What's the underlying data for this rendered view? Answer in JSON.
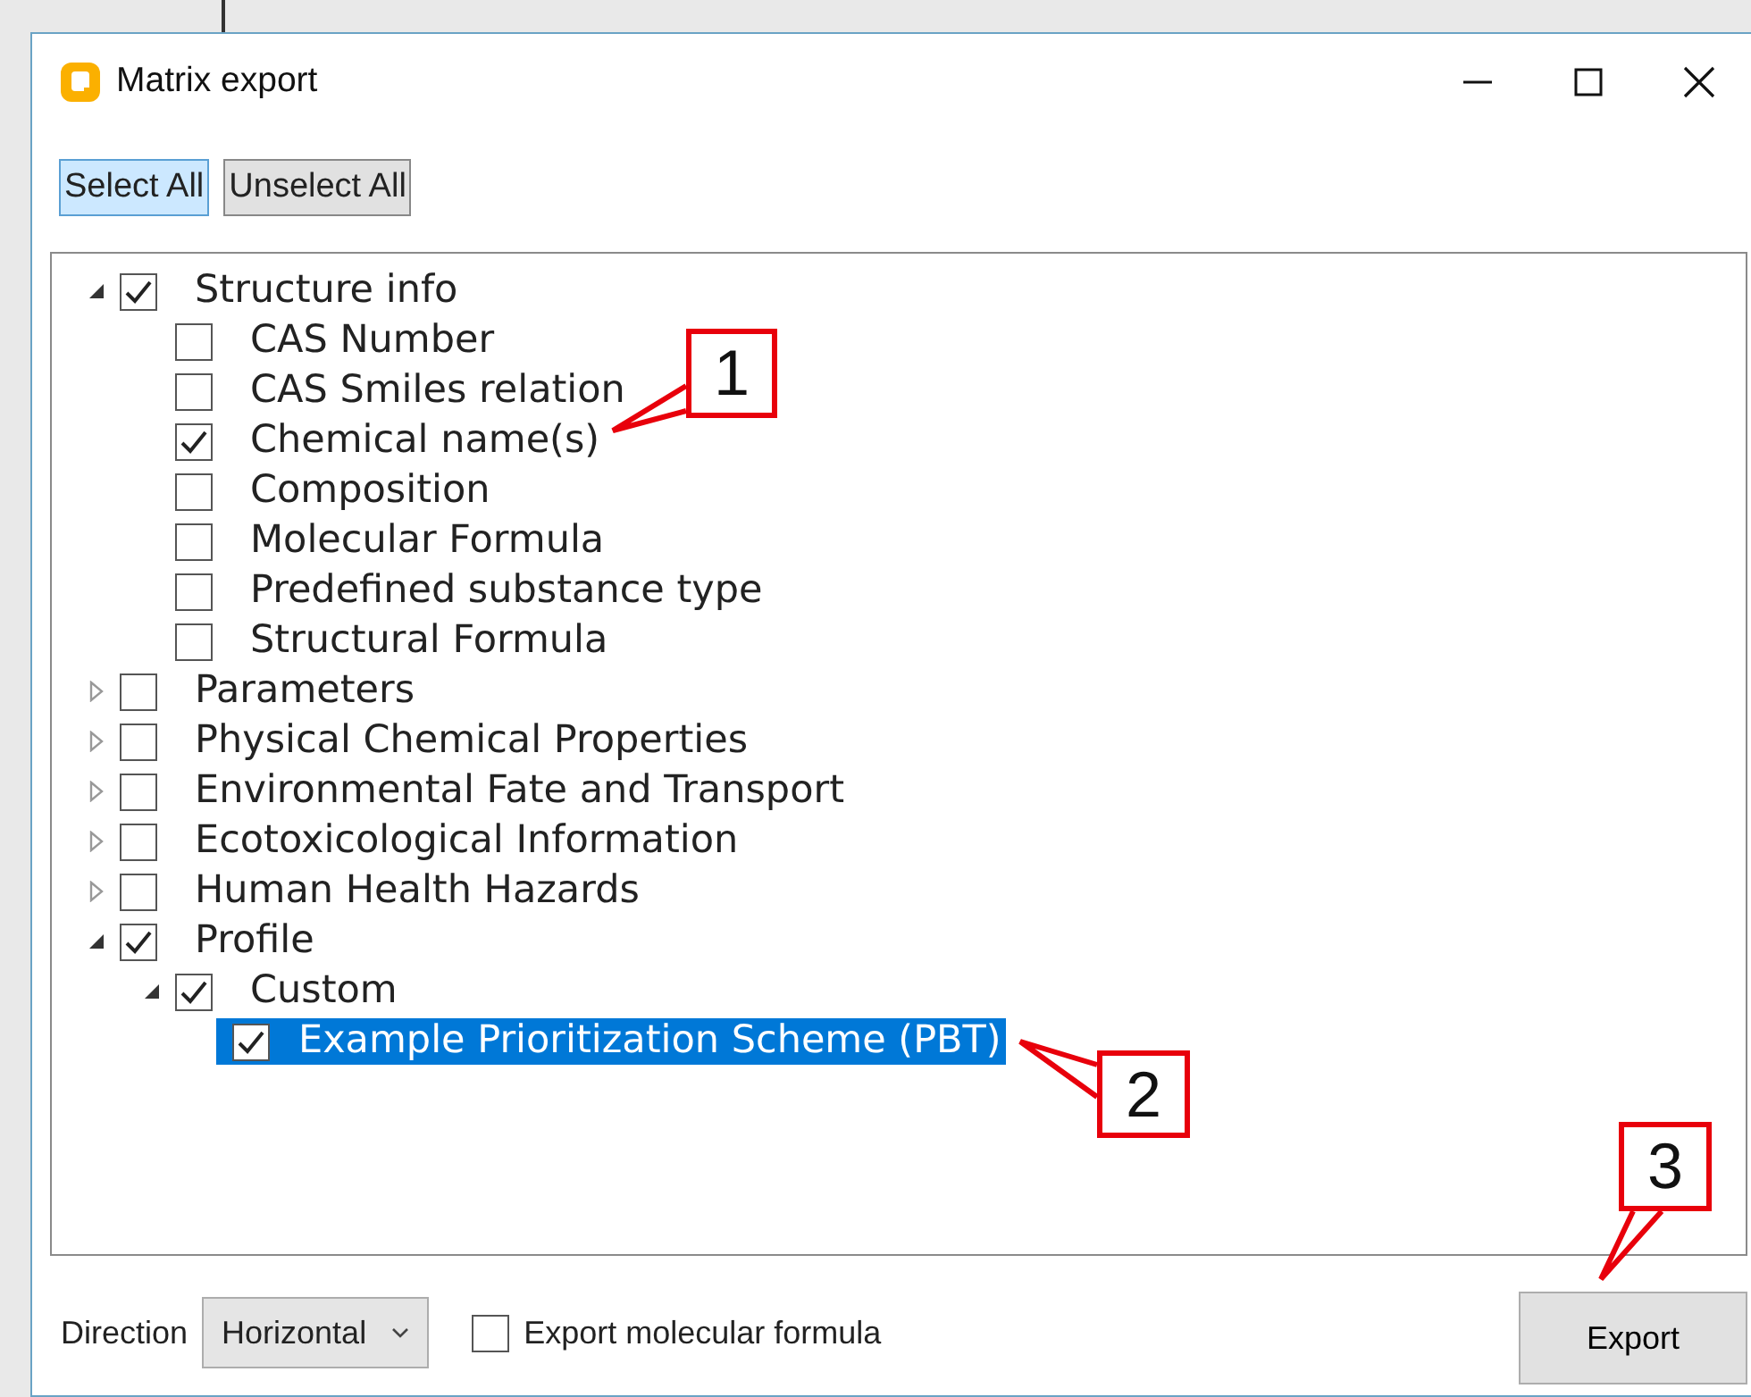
{
  "window": {
    "title": "Matrix export"
  },
  "toolbar": [
    {
      "label": "Select All",
      "selected": true
    },
    {
      "label": "Unselect All",
      "selected": false
    }
  ],
  "tree": [
    {
      "label": "Structure info",
      "checked": true,
      "expanded": true,
      "selected": false,
      "children": [
        {
          "label": "CAS Number",
          "checked": false,
          "selected": false
        },
        {
          "label": "CAS Smiles relation",
          "checked": false,
          "selected": false
        },
        {
          "label": "Chemical name(s)",
          "checked": true,
          "selected": false
        },
        {
          "label": "Composition",
          "checked": false,
          "selected": false
        },
        {
          "label": "Molecular Formula",
          "checked": false,
          "selected": false
        },
        {
          "label": "Predefined substance type",
          "checked": false,
          "selected": false
        },
        {
          "label": "Structural Formula",
          "checked": false,
          "selected": false
        }
      ]
    },
    {
      "label": "Parameters",
      "checked": false,
      "expanded": false,
      "selected": false
    },
    {
      "label": "Physical Chemical Properties",
      "checked": false,
      "expanded": false,
      "selected": false
    },
    {
      "label": "Environmental Fate and Transport",
      "checked": false,
      "expanded": false,
      "selected": false
    },
    {
      "label": "Ecotoxicological Information",
      "checked": false,
      "expanded": false,
      "selected": false
    },
    {
      "label": "Human Health Hazards",
      "checked": false,
      "expanded": false,
      "selected": false
    },
    {
      "label": "Profile",
      "checked": true,
      "expanded": true,
      "selected": false,
      "children": [
        {
          "label": "Custom",
          "checked": true,
          "expanded": true,
          "selected": false,
          "children": [
            {
              "label": "Example Prioritization Scheme (PBT)",
              "checked": true,
              "selected": true
            }
          ]
        }
      ]
    }
  ],
  "footer": {
    "direction_label": "Direction",
    "direction_value": "Horizontal",
    "export_formula": {
      "label": "Export molecular formula",
      "checked": false
    },
    "export_button": "Export"
  },
  "callouts": [
    "1",
    "2",
    "3"
  ]
}
